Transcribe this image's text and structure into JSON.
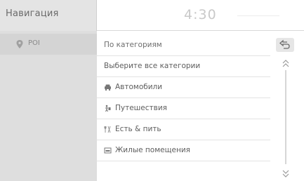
{
  "header": {
    "title": "Навигация",
    "time": "4:30"
  },
  "sidebar": {
    "items": [
      {
        "label": "POI",
        "icon": "poi-pin-icon"
      }
    ]
  },
  "list": {
    "header_label": "По категориям",
    "items": [
      {
        "label": "Выберите все категории",
        "icon": ""
      },
      {
        "label": "Автомобили",
        "icon": "car-icon"
      },
      {
        "label": "Путешествия",
        "icon": "travel-icon"
      },
      {
        "label": "Есть & пить",
        "icon": "food-icon"
      },
      {
        "label": "Жилые помещения",
        "icon": "lodging-icon"
      }
    ]
  },
  "controls": {
    "back_icon": "back-arrow-icon",
    "scroll_up_icon": "scroll-up-icon",
    "scroll_down_icon": "scroll-down-icon"
  },
  "colors": {
    "sidebar_bg": "#dedede",
    "accent_text": "#5e5e5e"
  }
}
